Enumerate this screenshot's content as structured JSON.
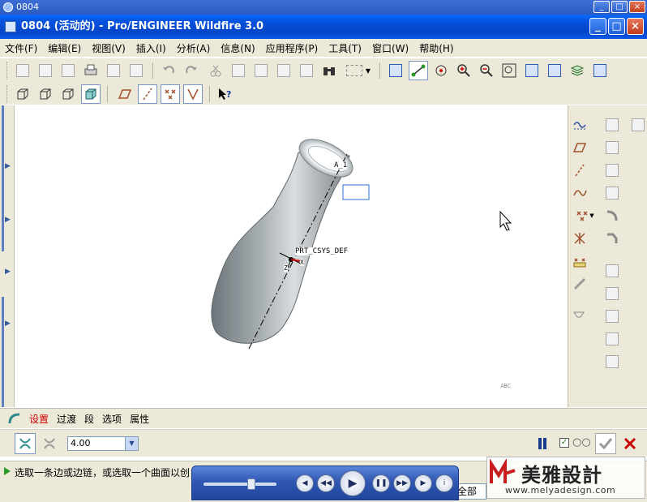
{
  "outer_window": {
    "title": "0804"
  },
  "window": {
    "title": "0804 (活动的) - Pro/ENGINEER Wildfire 3.0"
  },
  "menu": [
    "文件(F)",
    "编辑(E)",
    "视图(V)",
    "插入(I)",
    "分析(A)",
    "信息(N)",
    "应用程序(P)",
    "工具(T)",
    "窗口(W)",
    "帮助(H)"
  ],
  "viewport": {
    "labels": {
      "axis": "A_1",
      "csys": "PRT_CSYS_DEF",
      "axis_x": "X",
      "axis_z": "Z"
    },
    "view_tag": "ABC"
  },
  "dashboard": {
    "tabs": [
      "设置",
      "过渡",
      "段",
      "选项",
      "属性"
    ],
    "value": "4.00"
  },
  "status": {
    "message": "选取一条边或边链，或选取一个曲面以创",
    "filter": "全部"
  },
  "watermark": {
    "brand": "美雅設計",
    "url": "www.melyadesign.com"
  },
  "colors": {
    "accent": "#0246c8",
    "active_tab": "#d40000",
    "confirm": "#2a7a2a",
    "cancel": "#c80000"
  }
}
